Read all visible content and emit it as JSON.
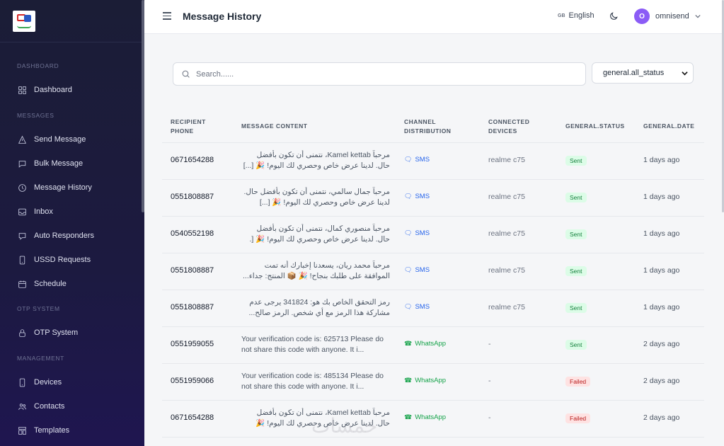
{
  "app": {
    "title": "Message History"
  },
  "sidebar": {
    "sections": [
      {
        "label": "DASHBOARD",
        "items": [
          {
            "label": "Dashboard",
            "icon": "dashboard-grid-icon"
          }
        ]
      },
      {
        "label": "MESSAGES",
        "items": [
          {
            "label": "Send Message",
            "icon": "send-icon"
          },
          {
            "label": "Bulk Message",
            "icon": "chat-icon"
          },
          {
            "label": "Message History",
            "icon": "clock-icon"
          },
          {
            "label": "Inbox",
            "icon": "inbox-icon"
          },
          {
            "label": "Auto Responders",
            "icon": "chat-bubble-icon"
          },
          {
            "label": "USSD Requests",
            "icon": "phone-icon"
          },
          {
            "label": "Schedule",
            "icon": "calendar-icon"
          }
        ]
      },
      {
        "label": "OTP SYSTEM",
        "items": [
          {
            "label": "OTP System",
            "icon": "lock-icon"
          }
        ]
      },
      {
        "label": "MANAGEMENT",
        "items": [
          {
            "label": "Devices",
            "icon": "mobile-device-icon"
          },
          {
            "label": "Contacts",
            "icon": "users-icon"
          },
          {
            "label": "Templates",
            "icon": "template-icon"
          }
        ]
      }
    ]
  },
  "header": {
    "title": "Message History",
    "language_flag": "GB",
    "language": "English",
    "user_initial": "O",
    "user_name": "omnisend"
  },
  "filters": {
    "search_placeholder": "Search......",
    "status_selected": "general.all_status"
  },
  "table": {
    "columns": [
      "RECIPIENT PHONE",
      "MESSAGE CONTENT",
      "CHANNEL DISTRIBUTION",
      "CONNECTED DEVICES",
      "GENERAL.STATUS",
      "GENERAL.DATE"
    ],
    "rows": [
      {
        "phone": "0671654288",
        "message": "مرحباً Kamel kettab، نتمنى أن تكون بأفضل حال. لدينا عرض خاص وحصري لك اليوم! 🎉 [...]",
        "rtl": true,
        "channel": "SMS",
        "device": "realme c75",
        "status": "Sent",
        "date": "1 days ago"
      },
      {
        "phone": "0551808887",
        "message": "مرحباً جمال سالمي، نتمنى أن تكون بأفضل حال. لدينا عرض خاص وحصري لك اليوم! 🎉 [...]",
        "rtl": true,
        "channel": "SMS",
        "device": "realme c75",
        "status": "Sent",
        "date": "1 days ago"
      },
      {
        "phone": "0540552198",
        "message": "مرحباً منصوري كمال، نتمنى أن تكون بأفضل حال. لدينا عرض خاص وحصري لك اليوم! 🎉 [.",
        "rtl": true,
        "channel": "SMS",
        "device": "realme c75",
        "status": "Sent",
        "date": "1 days ago"
      },
      {
        "phone": "0551808887",
        "message": "مرحباً محمد ريان، يسعدنا إخبارك أنه تمت الموافقة على طلبك بنجاح! 🎉 📦 المنتج: جداء...",
        "rtl": true,
        "channel": "SMS",
        "device": "realme c75",
        "status": "Sent",
        "date": "1 days ago"
      },
      {
        "phone": "0551808887",
        "message": "رمز التحقق الخاص بك هو: 341824 يرجى عدم مشاركة هذا الرمز مع أي شخص. الرمز صالح...",
        "rtl": true,
        "channel": "SMS",
        "device": "realme c75",
        "status": "Sent",
        "date": "1 days ago"
      },
      {
        "phone": "0551959055",
        "message": "Your verification code is: 625713 Please do not share this code with anyone. It i...",
        "rtl": false,
        "channel": "WhatsApp",
        "device": "-",
        "status": "Sent",
        "date": "2 days ago"
      },
      {
        "phone": "0551959066",
        "message": "Your verification code is: 485134 Please do not share this code with anyone. It i...",
        "rtl": false,
        "channel": "WhatsApp",
        "device": "-",
        "status": "Failed",
        "date": "2 days ago"
      },
      {
        "phone": "0671654288",
        "message": "مرحباً Kamel kettab، نتمنى أن تكون بأفضل حال. لدينا عرض خاص وحصري لك اليوم! 🎉",
        "rtl": true,
        "channel": "WhatsApp",
        "device": "-",
        "status": "Failed",
        "date": "2 days ago"
      }
    ]
  },
  "colors": {
    "sidebar_bg": "#1b1d36",
    "accent": "#8b5cf6",
    "sms": "#2563eb",
    "whatsapp": "#16a34a",
    "sent": "#15803d",
    "failed": "#b91c1c"
  }
}
